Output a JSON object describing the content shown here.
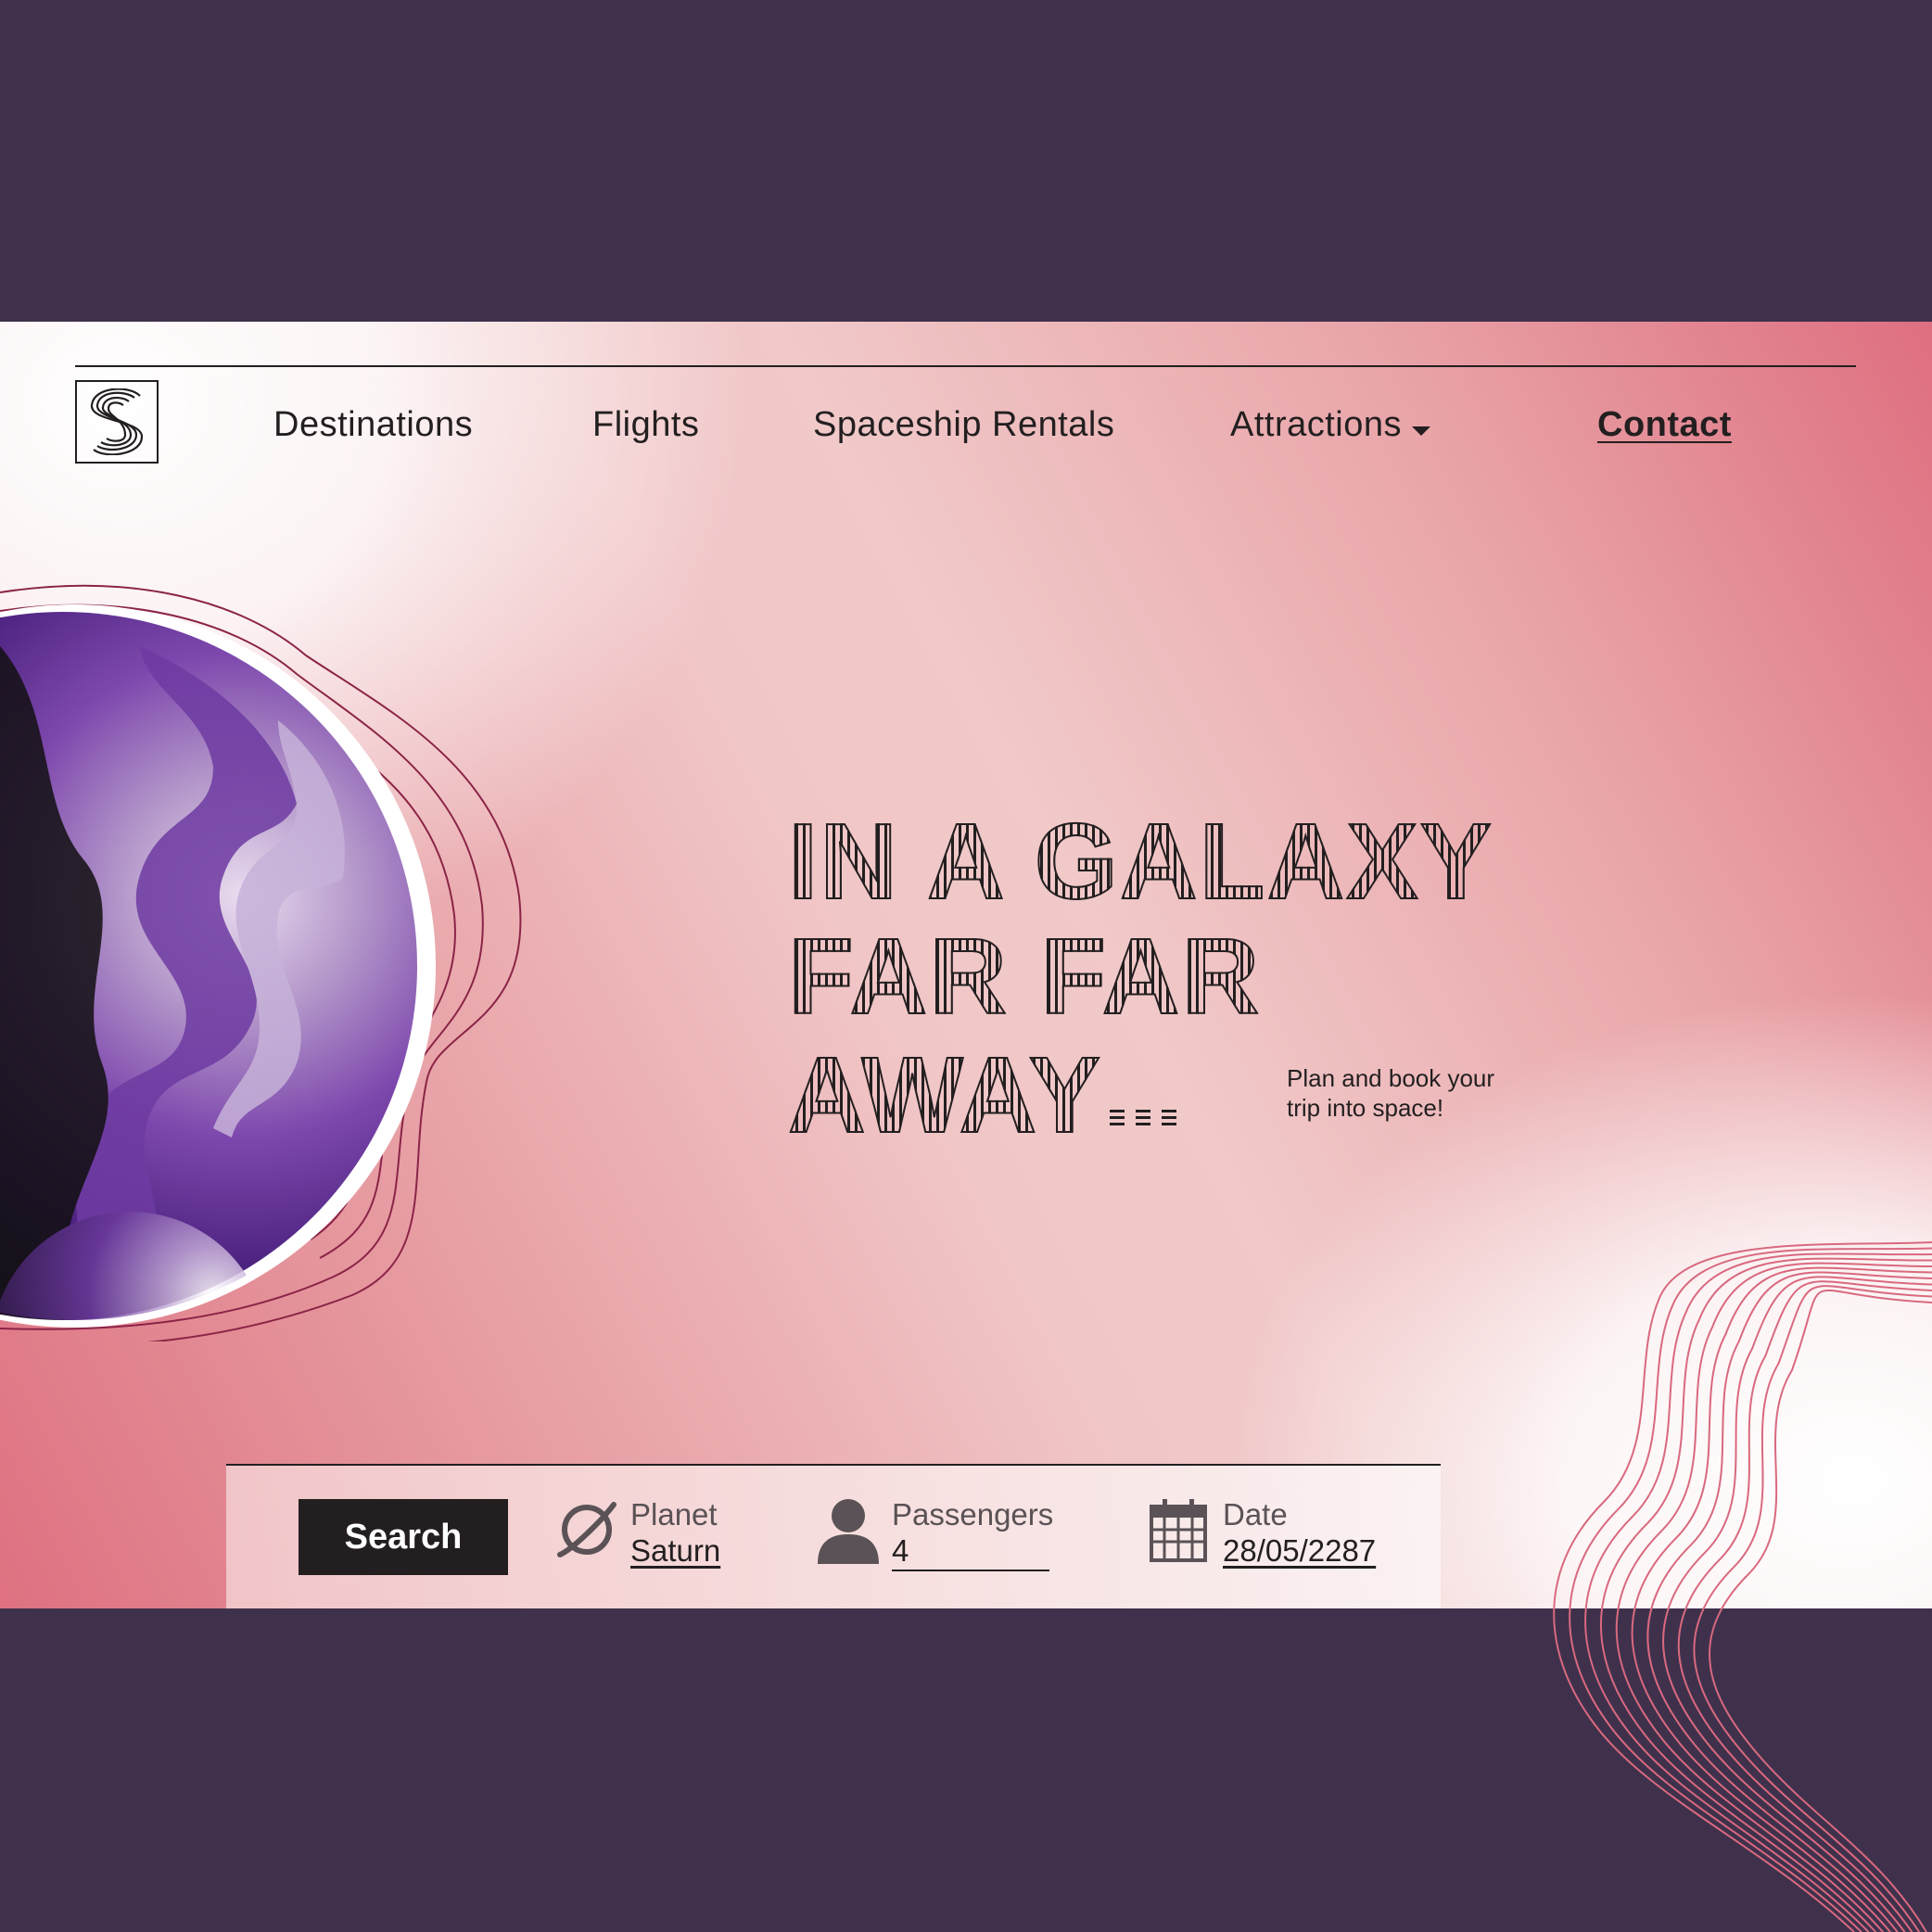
{
  "nav": {
    "items": [
      {
        "label": "Destinations"
      },
      {
        "label": "Flights"
      },
      {
        "label": "Spaceship Rentals"
      },
      {
        "label": "Attractions"
      }
    ],
    "contact_label": "Contact"
  },
  "hero": {
    "headline_lines": [
      "IN A GALAXY",
      "FAR FAR",
      "AWAY"
    ],
    "tagline": "Plan and book your trip into space!"
  },
  "search": {
    "button_label": "Search",
    "planet": {
      "label": "Planet",
      "value": "Saturn"
    },
    "passengers": {
      "label": "Passengers",
      "value": "4"
    },
    "date": {
      "label": "Date",
      "value": "28/05/2287"
    }
  },
  "colors": {
    "background": "#3f314c",
    "ink": "#231f20",
    "accent_pink": "#de6f80",
    "planet_purple": "#5b2a8c"
  },
  "icons": {
    "logo": "stylized-s-logo",
    "attractions_caret": "caret-down-icon",
    "planet": "planet-ring-icon",
    "passengers": "person-icon",
    "date": "calendar-icon"
  }
}
